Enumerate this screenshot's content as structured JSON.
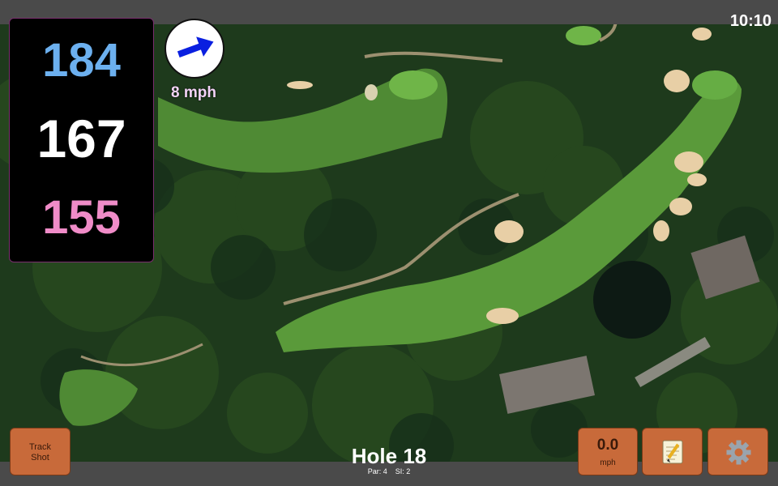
{
  "status": {
    "time": "10:10"
  },
  "distances": {
    "back": "184",
    "middle": "167",
    "front": "155"
  },
  "wind": {
    "speed_label": "8 mph",
    "icon": "arrow-icon",
    "direction": "east-northeast"
  },
  "buttons": {
    "track_shot_line1": "Track",
    "track_shot_line2": "Shot",
    "speed_value": "0.0",
    "speed_unit": "mph",
    "notes_icon": "notepad-icon",
    "settings_icon": "gear-icon"
  },
  "hole": {
    "title": "Hole 18",
    "par": "Par: 4",
    "stroke_index": "SI: 2"
  },
  "colors": {
    "back": "#6cb0ef",
    "middle": "#ffffff",
    "front": "#f08cc8",
    "button": "#c86a3a",
    "bar": "#4a4a4a"
  }
}
